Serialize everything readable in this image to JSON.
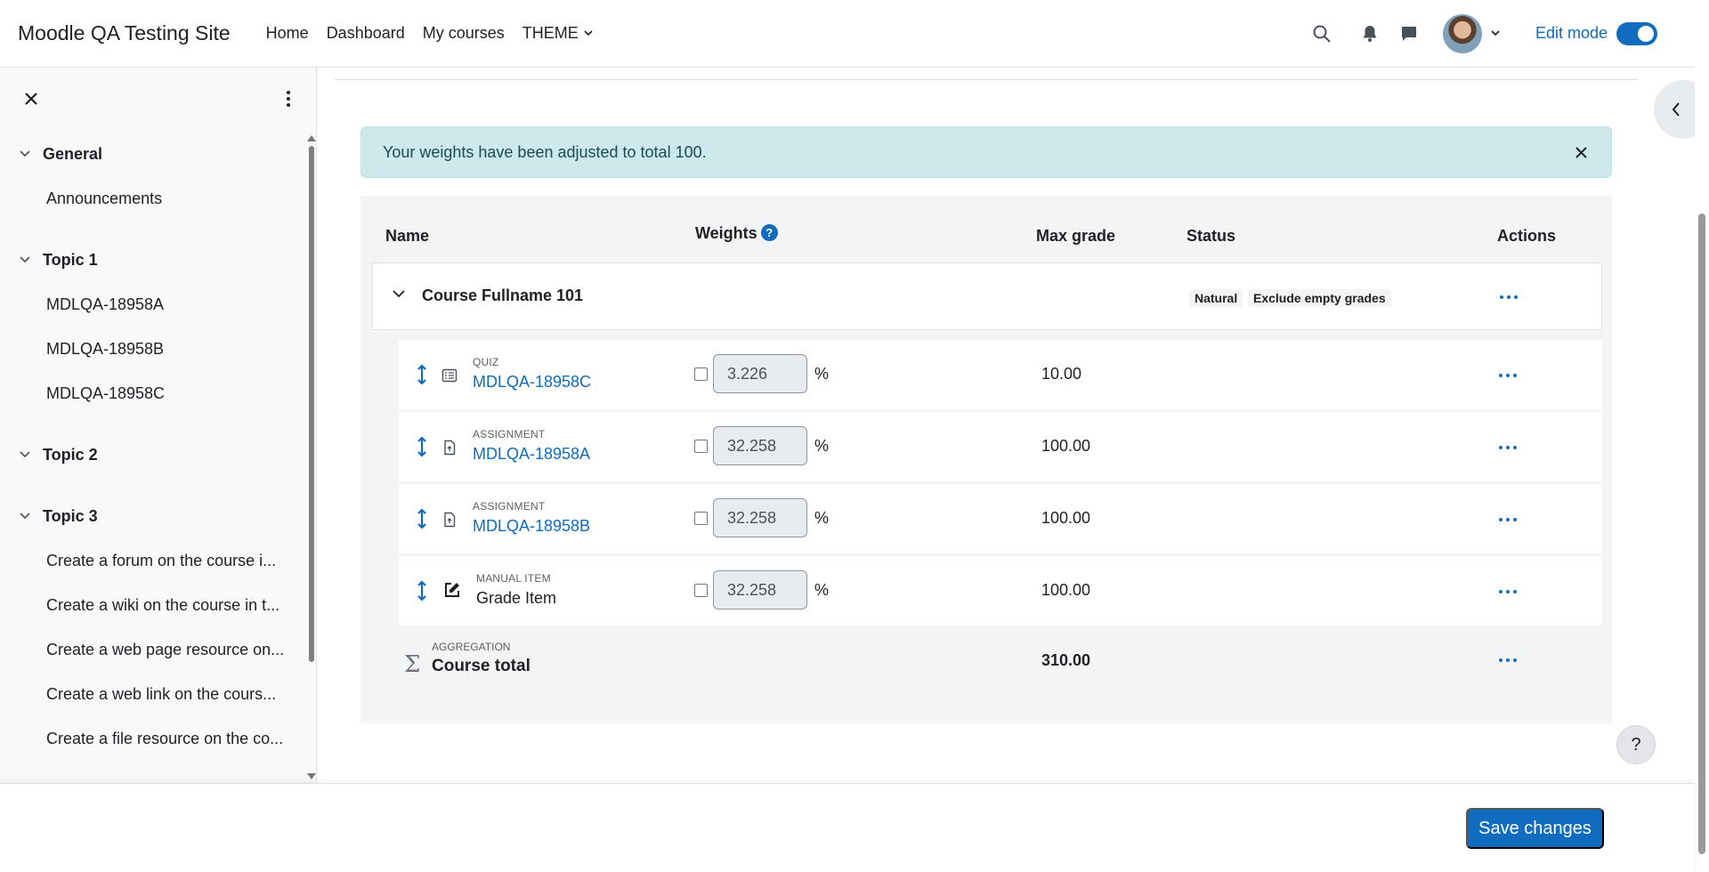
{
  "navbar": {
    "brand": "Moodle QA Testing Site",
    "links": [
      "Home",
      "Dashboard",
      "My courses",
      "THEME"
    ],
    "edit_mode_label": "Edit mode",
    "edit_mode_on": true
  },
  "drawer": {
    "sections": [
      {
        "title": "General",
        "items": [
          "Announcements"
        ]
      },
      {
        "title": "Topic 1",
        "items": [
          "MDLQA-18958A",
          "MDLQA-18958B",
          "MDLQA-18958C"
        ]
      },
      {
        "title": "Topic 2",
        "items": []
      },
      {
        "title": "Topic 3",
        "items": [
          "Create a forum on the course i...",
          "Create a wiki on the course in t...",
          "Create a web page resource on...",
          "Create a web link on the cours...",
          "Create a file resource on the co..."
        ]
      }
    ]
  },
  "alert": {
    "message": "Your weights have been adjusted to total 100."
  },
  "table": {
    "headers": {
      "name": "Name",
      "weights": "Weights",
      "weights_help": "?",
      "max_grade": "Max grade",
      "status": "Status",
      "actions": "Actions"
    },
    "category": {
      "name": "Course Fullname 101",
      "badges": [
        "Natural",
        "Exclude empty grades"
      ]
    },
    "items": [
      {
        "type": "QUIZ",
        "name": "MDLQA-18958C",
        "weight": "3.226",
        "pct": "%",
        "max_grade": "10.00",
        "icon": "quiz-icon",
        "link": true
      },
      {
        "type": "ASSIGNMENT",
        "name": "MDLQA-18958A",
        "weight": "32.258",
        "pct": "%",
        "max_grade": "100.00",
        "icon": "assignment-icon",
        "link": true
      },
      {
        "type": "ASSIGNMENT",
        "name": "MDLQA-18958B",
        "weight": "32.258",
        "pct": "%",
        "max_grade": "100.00",
        "icon": "assignment-icon",
        "link": true
      },
      {
        "type": "MANUAL ITEM",
        "name": "Grade Item",
        "weight": "32.258",
        "pct": "%",
        "max_grade": "100.00",
        "icon": "edit-icon",
        "link": false
      }
    ],
    "total": {
      "type": "AGGREGATION",
      "name": "Course total",
      "max_grade": "310.00"
    }
  },
  "help_button": "?",
  "footer": {
    "save_label": "Save changes"
  },
  "colors": {
    "accent": "#0f6cbf",
    "alert_bg": "#cde9ec"
  }
}
